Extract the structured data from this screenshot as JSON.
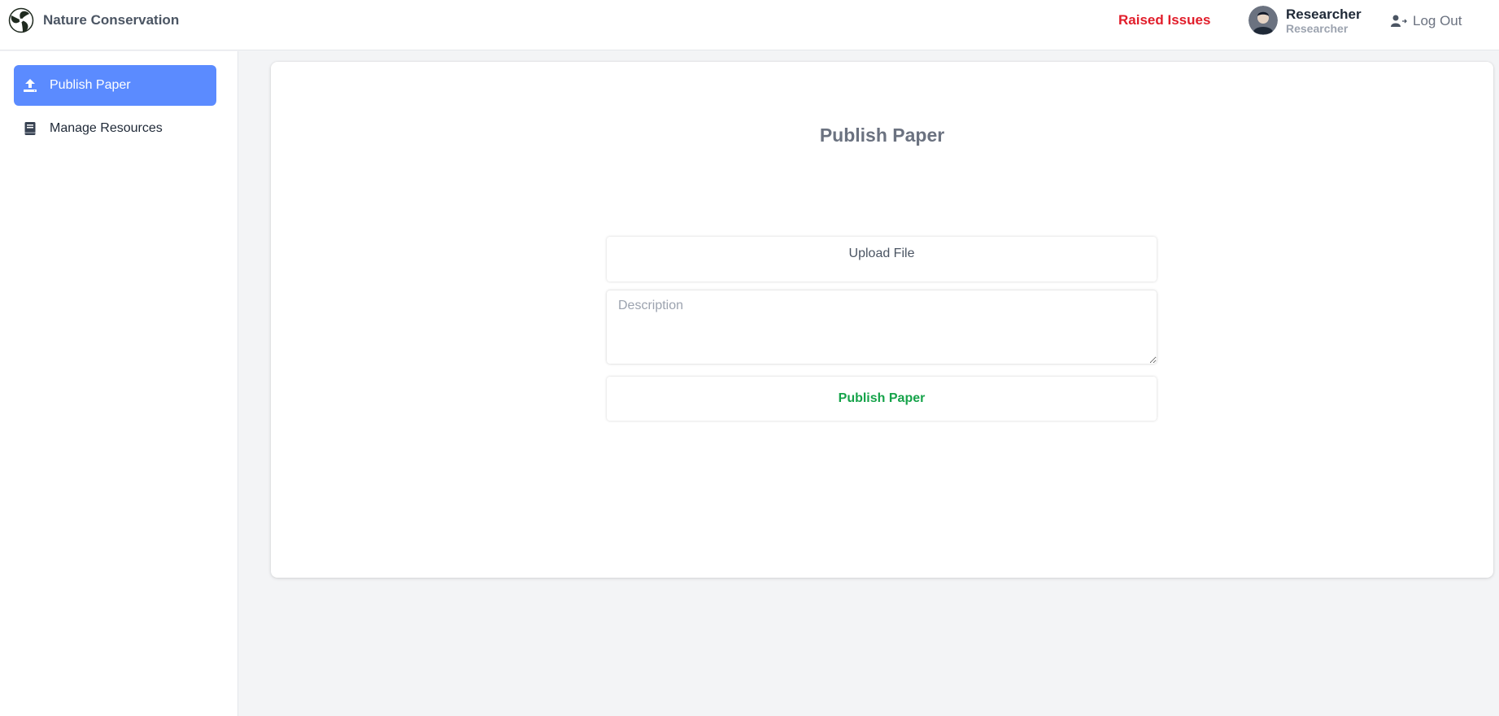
{
  "header": {
    "brand_name": "Nature Conservation",
    "raised_issues_label": "Raised Issues",
    "user": {
      "name": "Researcher",
      "role": "Researcher"
    },
    "logout_label": "Log Out"
  },
  "sidebar": {
    "items": [
      {
        "label": "Publish Paper",
        "icon": "upload-icon",
        "active": true
      },
      {
        "label": "Manage Resources",
        "icon": "book-icon",
        "active": false
      }
    ]
  },
  "main": {
    "title": "Publish Paper",
    "upload_label": "Upload File",
    "description": {
      "placeholder": "Description",
      "value": ""
    },
    "submit_label": "Publish Paper"
  },
  "colors": {
    "accent": "#5b8bff",
    "raised_issues": "#e11d2a",
    "publish_button_text": "#16a34a",
    "background": "#f3f4f6"
  }
}
